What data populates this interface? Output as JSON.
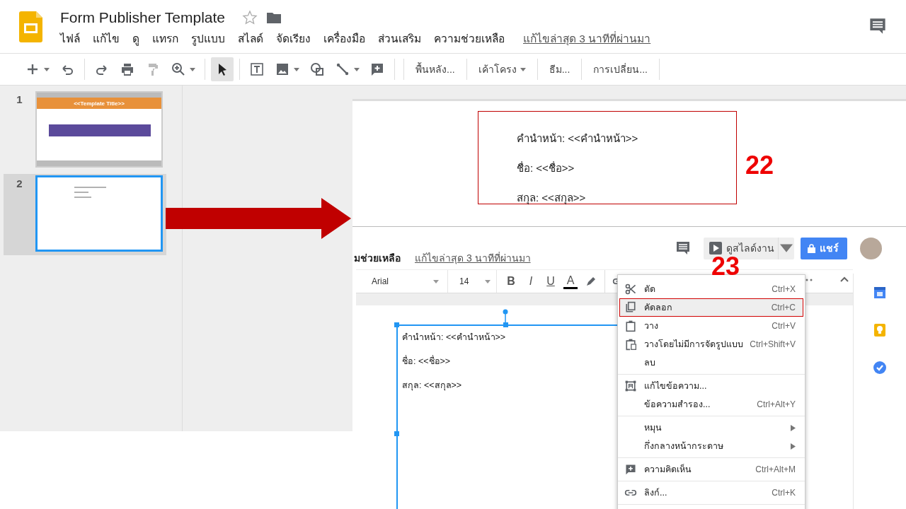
{
  "document": {
    "title": "Form Publisher Template",
    "starred": false
  },
  "menu": [
    "ไฟล์",
    "แก้ไข",
    "ดู",
    "แทรก",
    "รูปแบบ",
    "สไลด์",
    "จัดเรียง",
    "เครื่องมือ",
    "ส่วนเสริม",
    "ความช่วยเหลือ"
  ],
  "last_edit": "แก้ไขล่าสุด 3 นาทีที่ผ่านมา",
  "tools": [
    {
      "kind": "new",
      "selected": false,
      "dropdown": true
    },
    {
      "kind": "undo",
      "selected": false,
      "dropdown": false
    },
    {
      "kind": "redo",
      "selected": false,
      "dropdown": false
    },
    {
      "kind": "print",
      "selected": false,
      "dropdown": false
    },
    {
      "kind": "paint",
      "selected": false,
      "dropdown": false
    },
    {
      "kind": "zoom",
      "selected": false,
      "dropdown": true
    },
    {
      "kind": "select",
      "selected": true,
      "dropdown": false
    },
    {
      "kind": "textbox",
      "selected": false,
      "dropdown": false
    },
    {
      "kind": "image",
      "selected": false,
      "dropdown": true
    },
    {
      "kind": "shape",
      "selected": false,
      "dropdown": false
    },
    {
      "kind": "line",
      "selected": false,
      "dropdown": true
    },
    {
      "kind": "comment",
      "selected": false,
      "dropdown": false
    }
  ],
  "toolbar_buttons": [
    {
      "label": "พื้นหลัง...",
      "dropdown": false
    },
    {
      "label": "เค้าโครง",
      "dropdown": true
    },
    {
      "label": "ธีม...",
      "dropdown": false
    },
    {
      "label": "การเปลี่ยน...",
      "dropdown": false
    }
  ],
  "slides": [
    {
      "number": "1",
      "kind": "title",
      "title": "<<Template Title>>",
      "selected": false
    },
    {
      "number": "2",
      "kind": "text",
      "selected": true
    }
  ],
  "callout": {
    "lines": [
      "คำนำหน้า: <<คำนำหน้า>>",
      "ชื่อ: <<ชื่อ>>",
      "สกุล: <<สกุล>>"
    ],
    "step": "22"
  },
  "inset": {
    "menu_fragment": "มช่วยเหลือ",
    "last_edit": "แก้ไขล่าสุด 3 นาทีที่ผ่านมา",
    "present": "ดูสไลด์งาน",
    "share": "แชร์",
    "font": "Arial",
    "font_size": "14",
    "format_buttons": [
      {
        "kind": "bold",
        "label": "B"
      },
      {
        "kind": "italic",
        "label": "I"
      },
      {
        "kind": "underline",
        "label": "U"
      },
      {
        "kind": "color",
        "label": "A"
      }
    ],
    "textbox_lines": [
      "คำนำหน้า: <<คำนำหน้า>>",
      "ชื่อ: <<ชื่อ>>",
      "สกุล: <<สกุล>>"
    ],
    "step": "23",
    "context_menu": [
      [
        {
          "kind": "cut",
          "label": "ตัด",
          "shortcut": "Ctrl+X",
          "selected": false
        },
        {
          "kind": "copy",
          "label": "คัดลอก",
          "shortcut": "Ctrl+C",
          "selected": true
        },
        {
          "kind": "paste",
          "label": "วาง",
          "shortcut": "Ctrl+V",
          "selected": false
        },
        {
          "kind": "paste_plain",
          "label": "วางโดยไม่มีการจัดรูปแบบ",
          "shortcut": "Ctrl+Shift+V",
          "selected": false
        },
        {
          "kind": "none",
          "label": "ลบ",
          "selected": false
        }
      ],
      [
        {
          "kind": "edit_text",
          "label": "แก้ไขข้อความ...",
          "selected": false
        },
        {
          "kind": "none",
          "label": "ข้อความสำรอง...",
          "shortcut": "Ctrl+Alt+Y",
          "selected": false
        }
      ],
      [
        {
          "kind": "none",
          "label": "หมุน",
          "submenu": true,
          "selected": false
        },
        {
          "kind": "none",
          "label": "กึ่งกลางหน้ากระดาษ",
          "submenu": true,
          "selected": false
        }
      ],
      [
        {
          "kind": "comment",
          "label": "ความคิดเห็น",
          "shortcut": "Ctrl+Alt+M",
          "selected": false
        }
      ],
      [
        {
          "kind": "link",
          "label": "ลิงก์...",
          "shortcut": "Ctrl+K",
          "selected": false
        }
      ]
    ]
  }
}
